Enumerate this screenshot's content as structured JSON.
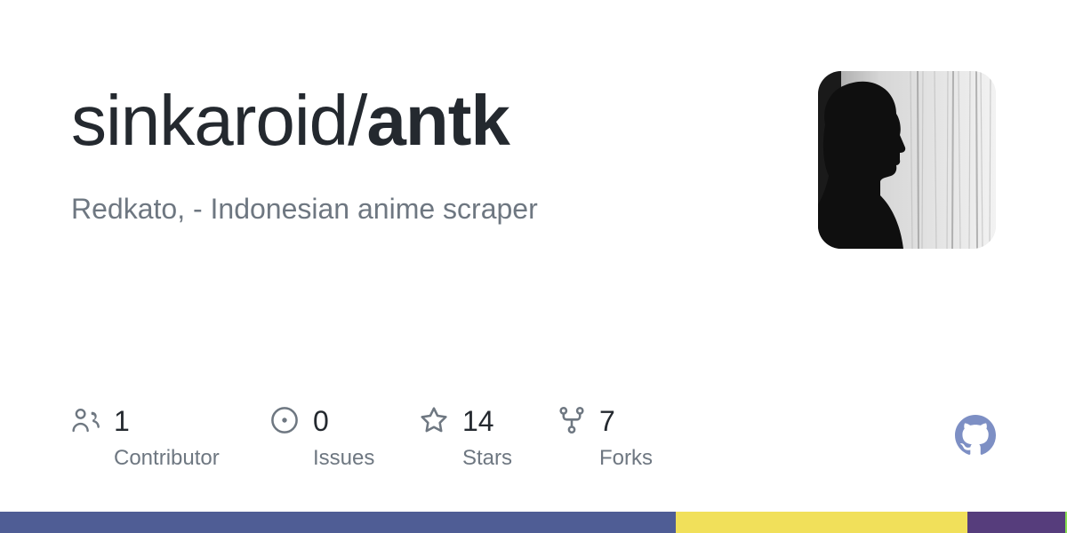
{
  "repo": {
    "owner": "sinkaroid/",
    "name": "antk",
    "description": "Redkato, - Indonesian anime scraper"
  },
  "avatar": {
    "icon": "silhouette-avatar"
  },
  "stats": {
    "contributors": {
      "value": "1",
      "label": "Contributor",
      "icon": "people-icon"
    },
    "issues": {
      "value": "0",
      "label": "Issues",
      "icon": "issue-opened-icon"
    },
    "stars": {
      "value": "14",
      "label": "Stars",
      "icon": "star-icon"
    },
    "forks": {
      "value": "7",
      "label": "Forks",
      "icon": "repo-forked-icon"
    }
  },
  "brand": {
    "icon": "github-mark-icon",
    "color": "#7d8fc4"
  },
  "languages": [
    {
      "color": "#4f5d95",
      "fraction": 0.633
    },
    {
      "color": "#f1e05a",
      "fraction": 0.274
    },
    {
      "color": "#563d7c",
      "fraction": 0.091
    },
    {
      "color": "#89e051",
      "fraction": 0.002
    }
  ]
}
